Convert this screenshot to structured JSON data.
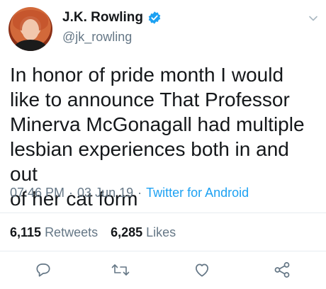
{
  "user": {
    "display_name": "J.K. Rowling",
    "handle": "@jk_rowling",
    "verified": true
  },
  "tweet": {
    "text": "In honor of pride month I would\nlike to announce That Professor\nMinerva McGonagall had multiple\nlesbian experiences both in and out\nof her cat form",
    "time": "07:46 PM",
    "date": "03 Jun 19",
    "source": "Twitter for Android",
    "separator": "·"
  },
  "stats": {
    "retweets_count": "6,115",
    "retweets_label": "Retweets",
    "likes_count": "6,285",
    "likes_label": "Likes"
  },
  "colors": {
    "accent": "#1da1f2",
    "secondary_text": "#657786",
    "text": "#14171a"
  },
  "icons": [
    "verified-icon",
    "chevron-down-icon",
    "reply-icon",
    "retweet-icon",
    "like-icon",
    "share-icon"
  ]
}
